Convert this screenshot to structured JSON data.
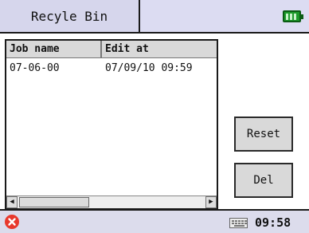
{
  "titlebar": {
    "title": "Recyle Bin",
    "battery_icon": "battery-full-icon"
  },
  "list": {
    "columns": [
      "Job name",
      "Edit at"
    ],
    "rows": [
      {
        "job_name": "07-06-00",
        "edit_at": "07/09/10 09:59"
      }
    ]
  },
  "buttons": {
    "reset_label": "Reset",
    "del_label": "Del"
  },
  "statusbar": {
    "close_icon": "close-icon",
    "keyboard_icon": "keyboard-icon",
    "time": "09:58"
  },
  "colors": {
    "title_bg": "#d6d6ec",
    "battery": "#1c9a2a",
    "close": "#e8382c",
    "status_bg": "#dcdcec"
  }
}
